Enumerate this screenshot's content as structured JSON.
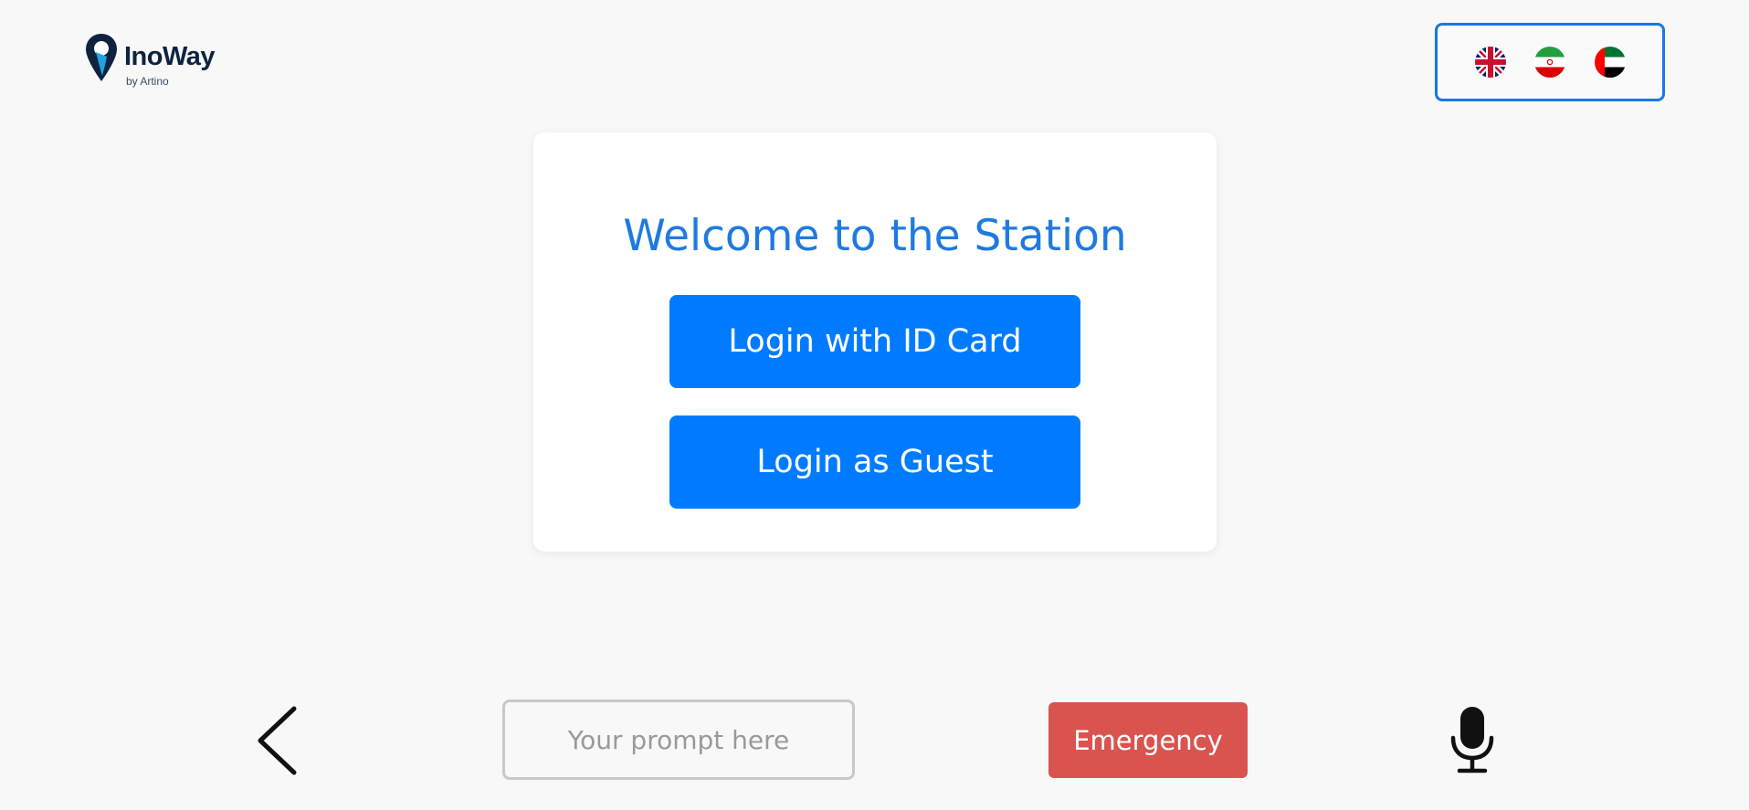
{
  "brand": {
    "name": "InoWay",
    "subtitle": "by Artino",
    "icon": "map-pin-logo"
  },
  "languages": [
    {
      "name": "English",
      "icon": "uk-flag-icon"
    },
    {
      "name": "Persian",
      "icon": "iran-flag-icon"
    },
    {
      "name": "Arabic",
      "icon": "uae-flag-icon"
    }
  ],
  "card": {
    "title": "Welcome to the Station",
    "id_card_button": "Login with ID Card",
    "guest_button": "Login as Guest"
  },
  "footer": {
    "back_icon": "chevron-left-icon",
    "prompt_placeholder": "Your prompt here",
    "prompt_value": "",
    "emergency_label": "Emergency",
    "mic_icon": "microphone-icon"
  },
  "colors": {
    "background": "#f8f8f8",
    "accent": "#007bff",
    "title": "#1f7ae0",
    "emergency": "#d9534f",
    "language_border": "#1877e8",
    "brand_dark": "#0f2340"
  }
}
